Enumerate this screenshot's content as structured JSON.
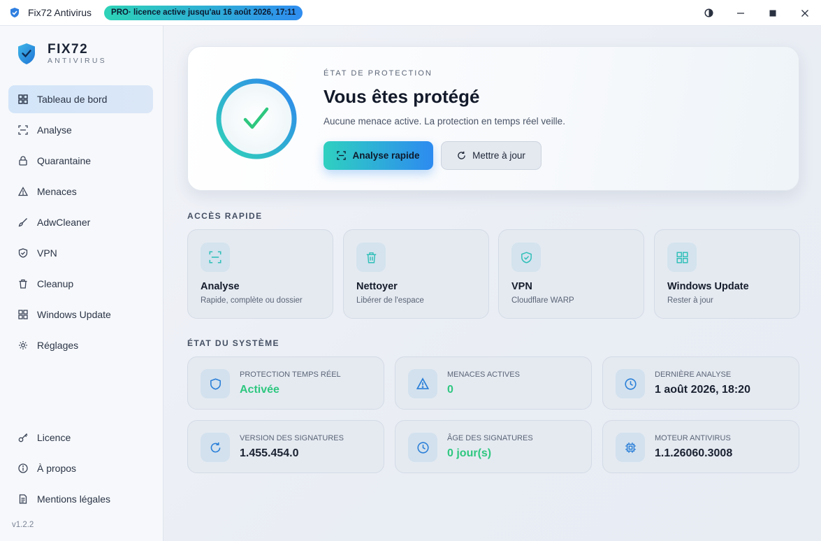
{
  "titlebar": {
    "app_title": "Fix72 Antivirus",
    "license_badge": "PRO· licence active jusqu'au 16 août 2026, 17:11",
    "controls": [
      "theme-toggle-icon",
      "minimize-icon",
      "maximize-icon",
      "close-icon"
    ]
  },
  "brand": {
    "name": "FIX72",
    "subtitle": "ANTIVIRUS"
  },
  "sidebar": {
    "items": [
      {
        "label": "Tableau de bord",
        "icon": "dashboard-grid-icon",
        "active": true
      },
      {
        "label": "Analyse",
        "icon": "scan-icon"
      },
      {
        "label": "Quarantaine",
        "icon": "lock-icon"
      },
      {
        "label": "Menaces",
        "icon": "warning-icon"
      },
      {
        "label": "AdwCleaner",
        "icon": "brush-icon"
      },
      {
        "label": "VPN",
        "icon": "shield-check-icon"
      },
      {
        "label": "Cleanup",
        "icon": "trash-icon"
      },
      {
        "label": "Windows Update",
        "icon": "windows-icon"
      },
      {
        "label": "Réglages",
        "icon": "gear-icon"
      }
    ],
    "bottom_items": [
      {
        "label": "Licence",
        "icon": "key-icon"
      },
      {
        "label": "À propos",
        "icon": "info-icon"
      },
      {
        "label": "Mentions légales",
        "icon": "document-icon"
      }
    ],
    "version": "v1.2.2"
  },
  "hero": {
    "kicker": "ÉTAT DE PROTECTION",
    "title": "Vous êtes protégé",
    "description": "Aucune menace active. La protection en temps réel veille.",
    "primary_button": "Analyse rapide",
    "secondary_button": "Mettre à jour"
  },
  "quick_access": {
    "title": "ACCÈS RAPIDE",
    "cards": [
      {
        "title": "Analyse",
        "subtitle": "Rapide, complète ou dossier",
        "icon": "scan-icon"
      },
      {
        "title": "Nettoyer",
        "subtitle": "Libérer de l'espace",
        "icon": "trash-icon"
      },
      {
        "title": "VPN",
        "subtitle": "Cloudflare WARP",
        "icon": "shield-check-icon"
      },
      {
        "title": "Windows Update",
        "subtitle": "Rester à jour",
        "icon": "windows-icon"
      }
    ]
  },
  "system_status": {
    "title": "ÉTAT DU SYSTÈME",
    "cards": [
      {
        "label": "PROTECTION TEMPS RÉEL",
        "value": "Activée",
        "icon": "shield-icon",
        "status": "green"
      },
      {
        "label": "MENACES ACTIVES",
        "value": "0",
        "icon": "warning-icon",
        "status": "green"
      },
      {
        "label": "DERNIÈRE ANALYSE",
        "value": "1 août 2026, 18:20",
        "icon": "clock-icon"
      },
      {
        "label": "VERSION DES SIGNATURES",
        "value": "1.455.454.0",
        "icon": "refresh-icon"
      },
      {
        "label": "ÂGE DES SIGNATURES",
        "value": "0 jour(s)",
        "icon": "clock-icon",
        "status": "green"
      },
      {
        "label": "MOTEUR ANTIVIRUS",
        "value": "1.1.26060.3008",
        "icon": "cpu-chip-icon"
      }
    ]
  },
  "colors": {
    "accent_teal": "#2fd0c0",
    "accent_blue": "#2d8bf0",
    "success_green": "#2ec77f"
  }
}
